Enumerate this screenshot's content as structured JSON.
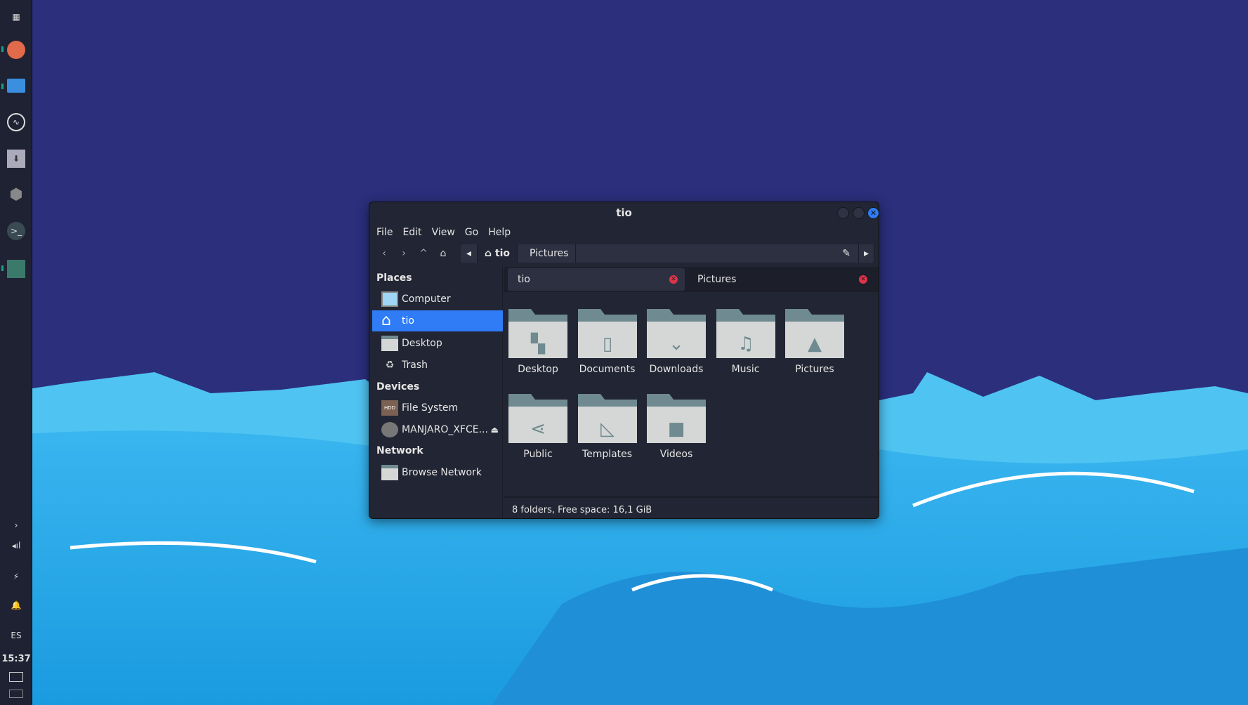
{
  "window": {
    "title": "tio"
  },
  "menu": [
    "File",
    "Edit",
    "View",
    "Go",
    "Help"
  ],
  "path": {
    "crumbs": [
      "tio",
      "Pictures"
    ]
  },
  "sidebar": {
    "places_header": "Places",
    "places": [
      "Computer",
      "tio",
      "Desktop",
      "Trash"
    ],
    "devices_header": "Devices",
    "devices": [
      "File System",
      "MANJARO_XFCE..."
    ],
    "network_header": "Network",
    "network": [
      "Browse Network"
    ],
    "selected": "tio"
  },
  "tabs": [
    {
      "label": "tio",
      "active": true
    },
    {
      "label": "Pictures",
      "active": false
    }
  ],
  "folders": [
    {
      "name": "Desktop",
      "icon": "desktop-icon"
    },
    {
      "name": "Documents",
      "icon": "document-icon"
    },
    {
      "name": "Downloads",
      "icon": "download-icon"
    },
    {
      "name": "Music",
      "icon": "music-icon"
    },
    {
      "name": "Pictures",
      "icon": "image-icon"
    },
    {
      "name": "Public",
      "icon": "share-icon"
    },
    {
      "name": "Templates",
      "icon": "templates-icon"
    },
    {
      "name": "Videos",
      "icon": "video-icon"
    }
  ],
  "status": "8 folders, Free space: 16,1 GiB",
  "panel": {
    "lang": "ES",
    "clock": "15:37"
  },
  "colors": {
    "accent": "#2f7cf6",
    "folder_front": "#d5d7d6",
    "folder_back": "#6f8a90",
    "close": "#e0334a"
  }
}
